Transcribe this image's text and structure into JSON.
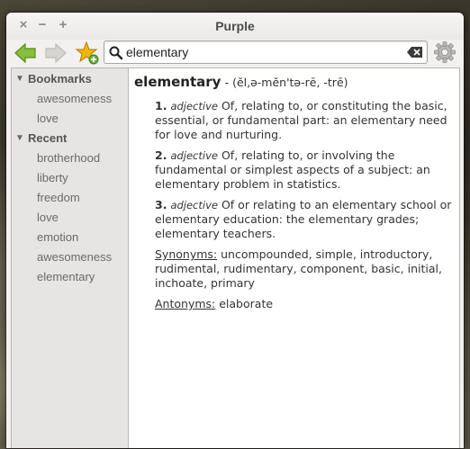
{
  "window": {
    "title": "Purple"
  },
  "toolbar": {
    "back_icon": "back-arrow-icon",
    "forward_icon": "forward-arrow-icon",
    "bookmark_icon": "add-bookmark-star-icon",
    "search_value": "elementary",
    "settings_icon": "gear-icon"
  },
  "sidebar": {
    "bookmarks": {
      "label": "Bookmarks",
      "items": [
        "awesomeness",
        "love"
      ]
    },
    "recent": {
      "label": "Recent",
      "items": [
        "brotherhood",
        "liberty",
        "freedom",
        "love",
        "emotion",
        "awesomeness",
        "elementary"
      ]
    }
  },
  "definition": {
    "word": "elementary",
    "pronunciation": "- (ĕl,ə-mĕn'tə-rē, -trē)",
    "senses": [
      {
        "num": "1.",
        "pos": "adjective",
        "text": "Of, relating to, or constituting the basic, essential, or fundamental part:  an elementary need for love and nurturing."
      },
      {
        "num": "2.",
        "pos": "adjective",
        "text": "Of, relating to, or involving the fundamental or simplest aspects of a subject:  an elementary problem in statistics."
      },
      {
        "num": "3.",
        "pos": "adjective",
        "text": "Of or relating to an elementary school or elementary education:  the elementary grades; elementary teachers."
      }
    ],
    "synonyms_label": "Synonyms:",
    "synonyms": "uncompounded, simple, introductory, rudimental, rudimentary, component, basic, initial, inchoate, primary",
    "antonyms_label": "Antonyms:",
    "antonyms": "elaborate"
  },
  "colors": {
    "accent_green": "#7cb342",
    "star": "#f0b400"
  }
}
